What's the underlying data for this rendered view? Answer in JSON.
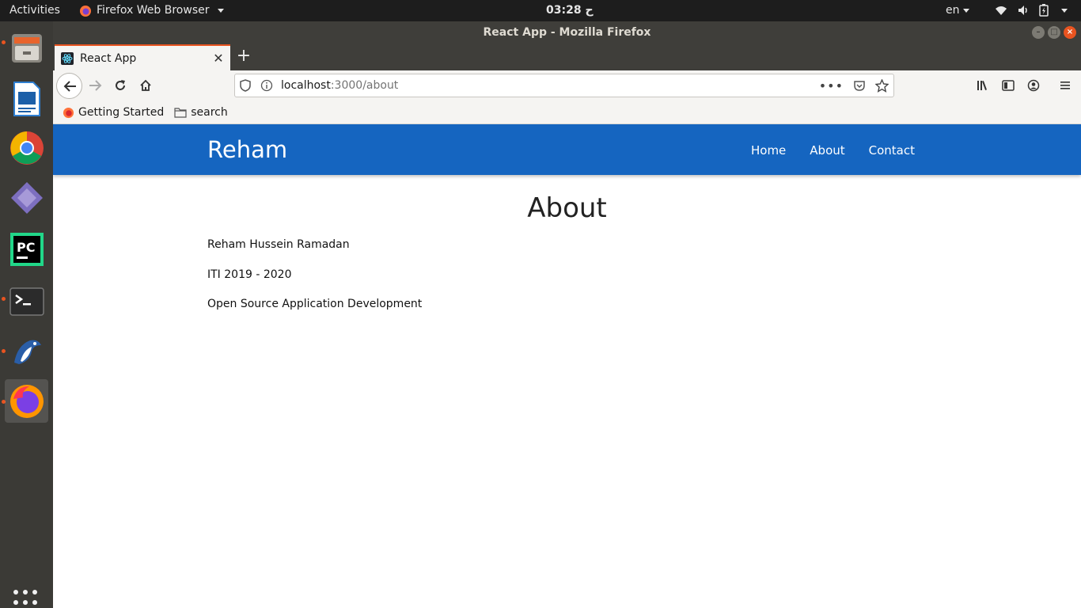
{
  "topbar": {
    "activities": "Activities",
    "app_name": "Firefox Web Browser",
    "clock": "ح 03:28",
    "language": "en"
  },
  "window": {
    "title": "React App - Mozilla Firefox"
  },
  "browser": {
    "tab_title": "React App",
    "url_host": "localhost",
    "url_rest": ":3000/about",
    "bookmarks": [
      "Getting Started",
      "search"
    ]
  },
  "site": {
    "brand": "Reham",
    "nav": [
      "Home",
      "About",
      "Contact"
    ],
    "heading": "About",
    "lines": [
      "Reham Hussein Ramadan",
      "ITI 2019 - 2020",
      "Open Source Application Development"
    ]
  },
  "colors": {
    "accent": "#e95420",
    "site_nav": "#1565c0"
  }
}
